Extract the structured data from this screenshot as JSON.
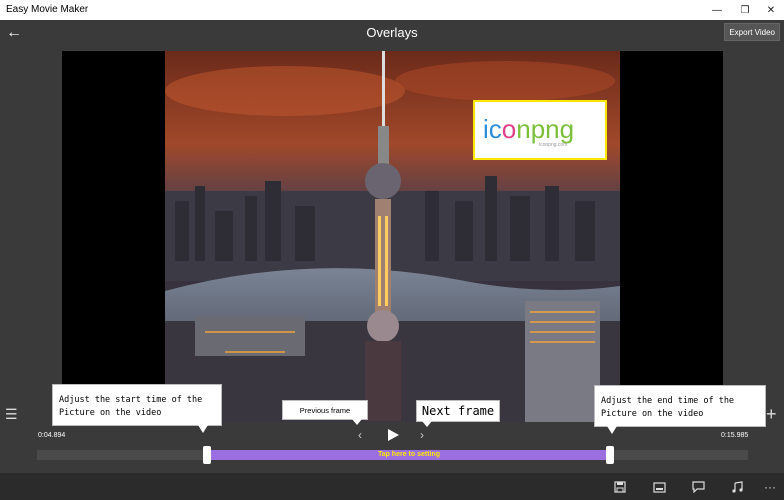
{
  "window": {
    "title": "Easy Movie Maker",
    "minimize_glyph": "—",
    "restore_glyph": "❐",
    "close_glyph": "✕"
  },
  "header": {
    "title": "Overlays",
    "back_glyph": "←",
    "export_label": "Export Video"
  },
  "overlay": {
    "logo_text_a": "ic",
    "logo_text_b": "o",
    "logo_text_c": "npng",
    "logo_sub": "iconpng.com"
  },
  "tooltips": {
    "start_line1": "Adjust the start time of the",
    "start_line2": "Picture on the video",
    "end_line1": "Adjust the end time of the",
    "end_line2": "Picture on the video",
    "prev_frame": "Previous frame",
    "next_frame": "Next frame"
  },
  "timeline": {
    "start_time": "0:04.894",
    "end_time": "0:15.985",
    "range_label": "Tap here to setting",
    "range_start": 0.24,
    "range_end": 0.805
  },
  "controls": {
    "prev_glyph": "‹",
    "next_glyph": "›",
    "list_glyph": "☰",
    "add_glyph": "+"
  },
  "bottombar": {
    "icons": [
      "save-icon",
      "caption-icon",
      "comment-icon",
      "music-icon",
      "more-icon"
    ],
    "more_glyph": "···"
  },
  "colors": {
    "range": "#9b6fe0",
    "range_text": "#ffe800",
    "overlay_border": "#ffe800"
  }
}
